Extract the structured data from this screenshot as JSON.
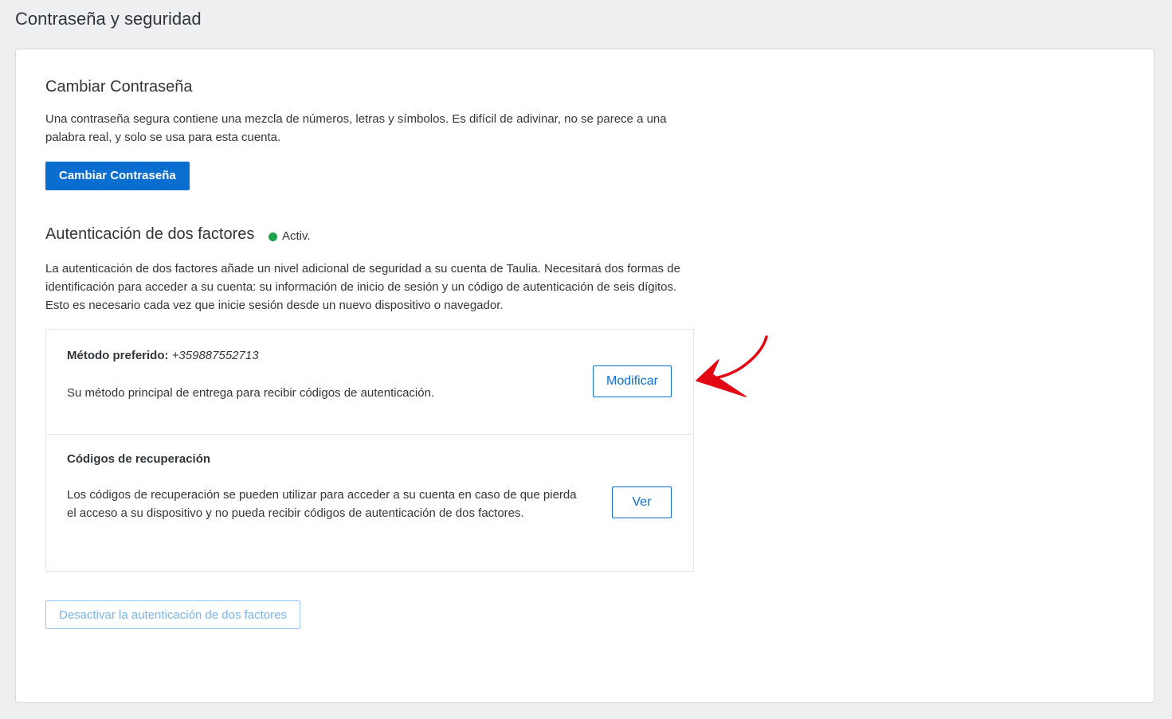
{
  "page": {
    "title": "Contraseña y seguridad"
  },
  "password": {
    "title": "Cambiar Contraseña",
    "description": "Una contraseña segura contiene una mezcla de números, letras y símbolos. Es difícil de adivinar, no se parece a una palabra real, y solo se usa para esta cuenta.",
    "button_label": "Cambiar Contraseña"
  },
  "two_factor": {
    "title": "Autenticación de dos factores",
    "status_label": "Activ.",
    "status_color": "#1ca34a",
    "description": "La autenticación de dos factores añade un nivel adicional de seguridad a su cuenta de Taulia. Necesitará dos formas de identificación para acceder a su cuenta: su información de inicio de sesión y un código de autenticación de seis dígitos. Esto es necesario cada vez que inicie sesión desde un nuevo dispositivo o navegador.",
    "preferred_method": {
      "label": "Método preferido:",
      "value": "+359887552713",
      "description": "Su método principal de entrega para recibir códigos de autenticación.",
      "button_label": "Modificar"
    },
    "recovery_codes": {
      "label": "Códigos de recuperación",
      "description": "Los códigos de recuperación se pueden utilizar para acceder a su cuenta en caso de que pierda el acceso a su dispositivo y no pueda recibir códigos de autenticación de dos factores.",
      "button_label": "Ver"
    },
    "disable_button_label": "Desactivar la autenticación de dos factores"
  },
  "annotation": {
    "arrow_icon": "red-arrow-icon",
    "color": "#e30613"
  },
  "colors": {
    "accent": "#0a6ed1",
    "background": "#edeff1"
  }
}
